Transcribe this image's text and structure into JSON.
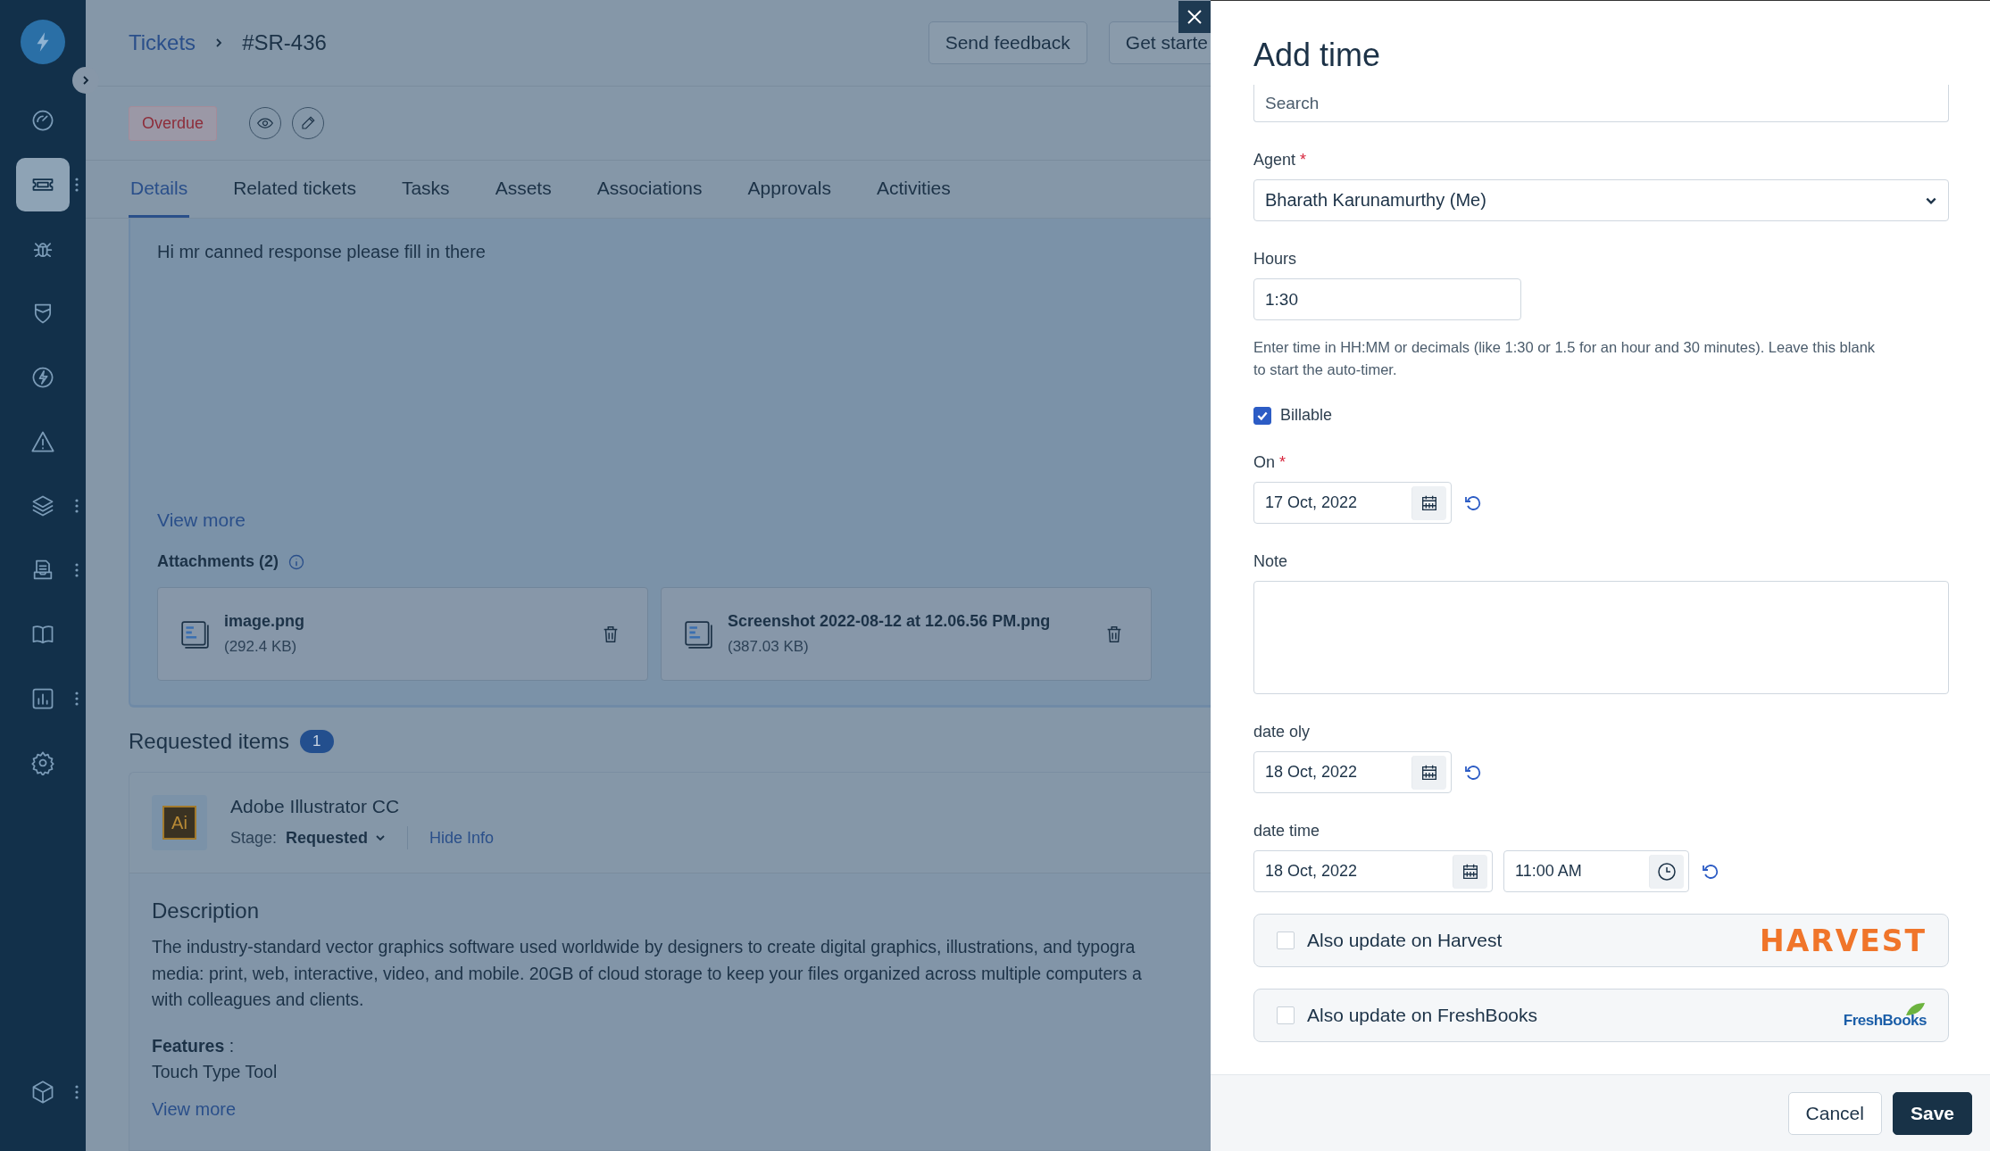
{
  "sidebar": {
    "items": [
      {
        "selected": false,
        "more": false
      },
      {
        "selected": true,
        "more": true
      },
      {
        "selected": false,
        "more": false
      },
      {
        "selected": false,
        "more": false
      },
      {
        "selected": false,
        "more": false
      },
      {
        "selected": false,
        "more": false
      },
      {
        "selected": false,
        "more": true
      },
      {
        "selected": false,
        "more": true
      },
      {
        "selected": false,
        "more": false
      },
      {
        "selected": false,
        "more": true
      },
      {
        "selected": false,
        "more": false
      }
    ],
    "footer_item": {
      "more": true
    }
  },
  "breadcrumb": {
    "parent": "Tickets",
    "current": "#SR-436"
  },
  "header_buttons": [
    "Send feedback",
    "Get starte"
  ],
  "status_badge": "Overdue",
  "tabs": [
    {
      "label": "Details",
      "selected": true
    },
    {
      "label": "Related tickets",
      "selected": false
    },
    {
      "label": "Tasks",
      "selected": false
    },
    {
      "label": "Assets",
      "selected": false
    },
    {
      "label": "Associations",
      "selected": false
    },
    {
      "label": "Approvals",
      "selected": false
    },
    {
      "label": "Activities",
      "selected": false
    }
  ],
  "details": {
    "message": "Hi mr canned response please fill in there",
    "view_more": "View more",
    "attachments_label": "Attachments (2)",
    "attachments": [
      {
        "name": "image.png",
        "size": "(292.4 KB)"
      },
      {
        "name": "Screenshot 2022-08-12 at 12.06.56 PM.png",
        "size": "(387.03 KB)"
      }
    ]
  },
  "requested_items": {
    "title": "Requested items",
    "count": "1",
    "item": {
      "icon_text": "Ai",
      "name": "Adobe Illustrator CC",
      "stage_label": "Stage:",
      "stage": "Requested",
      "hide_info": "Hide Info",
      "description_title": "Description",
      "description_lines": [
        "The industry-standard vector graphics software used worldwide by designers to create digital graphics, illustrations, and typogra",
        "media: print, web, interactive, video, and mobile. 20GB of cloud storage to keep your files organized across multiple computers a",
        "with colleagues and clients."
      ],
      "features_label": "**Features** :",
      "features": "Touch Type Tool",
      "view_more": "View more"
    }
  },
  "panel": {
    "title": "Add time",
    "search": {
      "placeholder": "Search"
    },
    "agent": {
      "label": "Agent",
      "required_mark": "*",
      "value": "Bharath Karunamurthy (Me)"
    },
    "hours": {
      "label": "Hours",
      "value": "1:30",
      "help": "Enter time in HH:MM or decimals (like 1:30 or 1.5 for an hour and 30 minutes). Leave this blank to start the auto-timer."
    },
    "billable": {
      "label": "Billable",
      "checked": true
    },
    "on": {
      "label": "On",
      "required_mark": "*",
      "value": "17 Oct, 2022"
    },
    "note": {
      "label": "Note"
    },
    "date_only": {
      "label": "date oly",
      "value": "18 Oct, 2022"
    },
    "date_time": {
      "label": "date time",
      "date": "18 Oct, 2022",
      "time": "11:00 AM"
    },
    "integrations": [
      {
        "label": "Also update on Harvest",
        "checked": false,
        "kind": "harvest",
        "logo": "HARVEST"
      },
      {
        "label": "Also update on FreshBooks",
        "checked": false,
        "kind": "freshbooks",
        "logo": "FreshBooks"
      }
    ],
    "buttons": {
      "cancel": "Cancel",
      "save": "Save"
    }
  }
}
